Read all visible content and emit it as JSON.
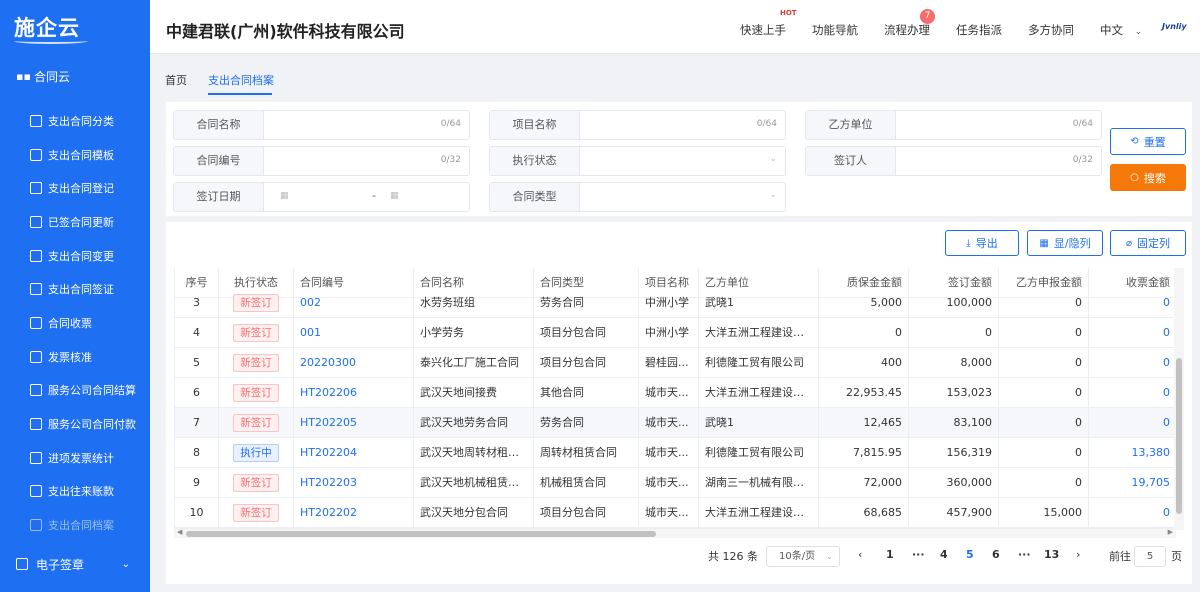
{
  "sidebar": {
    "logo": "施企云",
    "group": "合同云",
    "items": [
      {
        "label": "支出合同分类"
      },
      {
        "label": "支出合同模板"
      },
      {
        "label": "支出合同登记"
      },
      {
        "label": "已签合同更新"
      },
      {
        "label": "支出合同变更"
      },
      {
        "label": "支出合同签证"
      },
      {
        "label": "合同收票"
      },
      {
        "label": "发票核准"
      },
      {
        "label": "服务公司合同结算"
      },
      {
        "label": "服务公司合同付款"
      },
      {
        "label": "进项发票统计"
      },
      {
        "label": "支出往来账款"
      },
      {
        "label": "支出合同档案"
      }
    ],
    "bottom_group": "电子签章"
  },
  "header": {
    "company": "中建君联(广州)软件科技有限公司",
    "nav": [
      "快速上手",
      "功能导航",
      "流程办理",
      "任务指派",
      "多方协同"
    ],
    "hot_badge": "HOT",
    "flow_badge": "7",
    "language": "中文",
    "brand": "Jvnliy"
  },
  "tabs": [
    "首页",
    "支出合同档案"
  ],
  "filters": {
    "contract_name": {
      "label": "合同名称",
      "count": "0/64"
    },
    "project_name": {
      "label": "项目名称",
      "count": "0/64"
    },
    "party_b": {
      "label": "乙方单位",
      "count": "0/64"
    },
    "contract_no": {
      "label": "合同编号",
      "count": "0/32"
    },
    "exec_status": {
      "label": "执行状态"
    },
    "signer": {
      "label": "签订人",
      "count": "0/32"
    },
    "sign_date": {
      "label": "签订日期",
      "separator": "-"
    },
    "contract_type": {
      "label": "合同类型"
    }
  },
  "buttons": {
    "reset": "重置",
    "search": "搜索",
    "export": "导出",
    "columns": "显/隐列",
    "fix_col": "固定列"
  },
  "table": {
    "columns": [
      "序号",
      "执行状态",
      "合同编号",
      "合同名称",
      "合同类型",
      "项目名称",
      "乙方单位",
      "质保金金额",
      "签订金额",
      "乙方申报金额",
      "收票金额"
    ],
    "rows": [
      {
        "no": "3",
        "status": "新签订",
        "code": "002",
        "name": "水劳务班组",
        "type": "劳务合同",
        "project": "中洲小学",
        "party": "武晓1",
        "warranty": "5,000",
        "sign": "100,000",
        "declared": "0",
        "invoice": "0"
      },
      {
        "no": "4",
        "status": "新签订",
        "code": "001",
        "name": "小学劳务",
        "type": "项目分包合同",
        "project": "中洲小学",
        "party": "大洋五洲工程建设有...",
        "warranty": "0",
        "sign": "0",
        "declared": "0",
        "invoice": "0"
      },
      {
        "no": "5",
        "status": "新签订",
        "code": "20220300",
        "name": "泰兴化工厂施工合同",
        "type": "项目分包合同",
        "project": "碧桂园...",
        "party": "利德隆工贸有限公司",
        "warranty": "400",
        "sign": "8,000",
        "declared": "0",
        "invoice": "0"
      },
      {
        "no": "6",
        "status": "新签订",
        "code": "HT202206",
        "name": "武汉天地间接费",
        "type": "其他合同",
        "project": "城市天...",
        "party": "大洋五洲工程建设有...",
        "warranty": "22,953.45",
        "sign": "153,023",
        "declared": "0",
        "invoice": "0"
      },
      {
        "no": "7",
        "status": "新签订",
        "code": "HT202205",
        "name": "武汉天地劳务合同",
        "type": "劳务合同",
        "project": "城市天...",
        "party": "武晓1",
        "warranty": "12,465",
        "sign": "83,100",
        "declared": "0",
        "invoice": "0"
      },
      {
        "no": "8",
        "status": "执行中",
        "code": "HT202204",
        "name": "武汉天地周转材租赁...",
        "type": "周转材租赁合同",
        "project": "城市天...",
        "party": "利德隆工贸有限公司",
        "warranty": "7,815.95",
        "sign": "156,319",
        "declared": "0",
        "invoice": "13,380"
      },
      {
        "no": "9",
        "status": "新签订",
        "code": "HT202203",
        "name": "武汉天地机械租赁合...",
        "type": "机械租赁合同",
        "project": "城市天...",
        "party": "湖南三一机械有限公...",
        "warranty": "72,000",
        "sign": "360,000",
        "declared": "0",
        "invoice": "19,705"
      },
      {
        "no": "10",
        "status": "新签订",
        "code": "HT202202",
        "name": "武汉天地分包合同",
        "type": "项目分包合同",
        "project": "城市天...",
        "party": "大洋五洲工程建设有...",
        "warranty": "68,685",
        "sign": "457,900",
        "declared": "15,000",
        "invoice": "0"
      }
    ]
  },
  "pagination": {
    "total": "共 126 条",
    "page_size": "10条/页",
    "pages": [
      "1",
      "···",
      "4",
      "5",
      "6",
      "···",
      "13"
    ],
    "current": "5",
    "goto_label": "前往",
    "goto_value": "5",
    "goto_suffix": "页"
  }
}
